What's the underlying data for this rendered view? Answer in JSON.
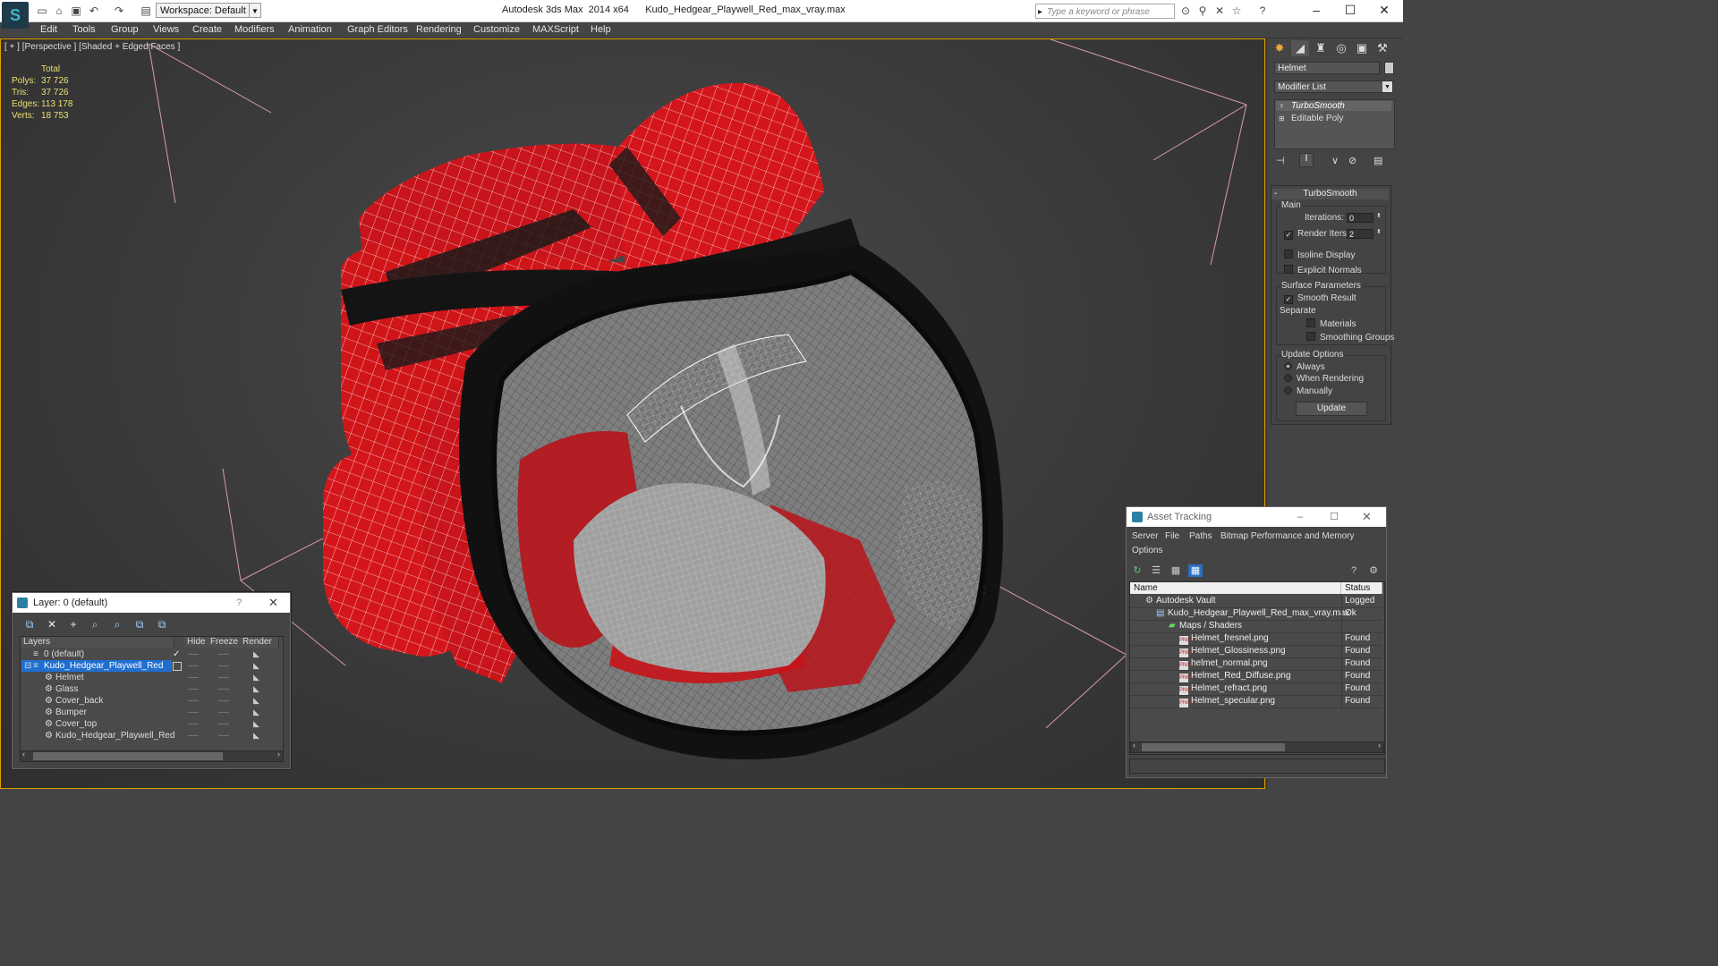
{
  "window": {
    "title": "Autodesk 3ds Max  2014 x64      Kudo_Hedgear_Playwell_Red_max_vray.max",
    "workspace_label": "Workspace: Default",
    "search_placeholder": "Type a keyword or phrase"
  },
  "menu": [
    "Edit",
    "Tools",
    "Group",
    "Views",
    "Create",
    "Modifiers",
    "Animation",
    "Graph Editors",
    "Rendering",
    "Customize",
    "MAXScript",
    "Help"
  ],
  "viewport": {
    "label": "[ + ] [Perspective ] [Shaded + Edged Faces ]",
    "stats": {
      "header": "Total",
      "rows": [
        {
          "label": "Polys:",
          "value": "37 726"
        },
        {
          "label": "Tris:",
          "value": "37 726"
        },
        {
          "label": "Edges:",
          "value": "113 178"
        },
        {
          "label": "Verts:",
          "value": "18 753"
        }
      ]
    },
    "colors": {
      "model_red": "#d4161c",
      "wire": "#ffffff",
      "grid": "#e8a0b8",
      "glass": "#8a8a8a"
    }
  },
  "command_panel": {
    "object_name": "Helmet",
    "modifier_list": "Modifier List",
    "stack": [
      "TurboSmooth",
      "Editable Poly"
    ],
    "rollout_title": "TurboSmooth",
    "main_group": "Main",
    "iterations_label": "Iterations:",
    "iterations_value": "0",
    "render_iters_label": "Render Iters:",
    "render_iters_value": "2",
    "isoline_display": "Isoline Display",
    "explicit_normals": "Explicit Normals",
    "surface_params": "Surface Parameters",
    "smooth_result": "Smooth Result",
    "separate": "Separate",
    "materials": "Materials",
    "smoothing_groups": "Smoothing Groups",
    "update_options": "Update Options",
    "always": "Always",
    "when_rendering": "When Rendering",
    "manually": "Manually",
    "update_button": "Update"
  },
  "layers_window": {
    "title": "Layer: 0 (default)",
    "help": "?",
    "columns": [
      "Layers",
      "Hide",
      "Freeze",
      "Render"
    ],
    "rows": [
      {
        "name": "0 (default)",
        "indent": 1
      },
      {
        "name": "Kudo_Hedgear_Playwell_Red",
        "indent": 1,
        "selected": true
      },
      {
        "name": "Helmet",
        "indent": 2
      },
      {
        "name": "Glass",
        "indent": 2
      },
      {
        "name": "Cover_back",
        "indent": 2
      },
      {
        "name": "Bumper",
        "indent": 2
      },
      {
        "name": "Cover_top",
        "indent": 2
      },
      {
        "name": "Kudo_Hedgear_Playwell_Red",
        "indent": 2
      }
    ],
    "dash": "----"
  },
  "asset_tracking": {
    "title": "Asset Tracking",
    "menu": [
      "Server",
      "File",
      "Paths",
      "Bitmap Performance and Memory",
      "Options"
    ],
    "columns": [
      "Name",
      "Status"
    ],
    "rows": [
      {
        "name": "Autodesk Vault",
        "status": "Logged O",
        "indent": 1
      },
      {
        "name": "Kudo_Hedgear_Playwell_Red_max_vray.max",
        "status": "Ok",
        "indent": 2
      },
      {
        "name": "Maps / Shaders",
        "status": "",
        "indent": 3
      },
      {
        "name": "Helmet_fresnel.png",
        "status": "Found",
        "indent": 4
      },
      {
        "name": "Helmet_Glossiness.png",
        "status": "Found",
        "indent": 4
      },
      {
        "name": "helmet_normal.png",
        "status": "Found",
        "indent": 4
      },
      {
        "name": "Helmet_Red_Diffuse.png",
        "status": "Found",
        "indent": 4
      },
      {
        "name": "Helmet_refract.png",
        "status": "Found",
        "indent": 4
      },
      {
        "name": "Helmet_specular.png",
        "status": "Found",
        "indent": 4
      }
    ]
  }
}
